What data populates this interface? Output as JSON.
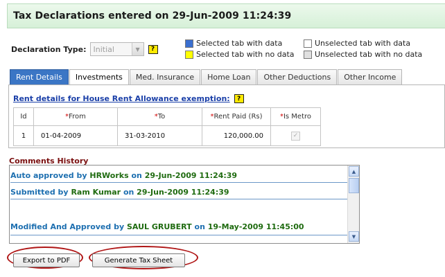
{
  "header": {
    "title": "Tax Declarations entered on 29-Jun-2009 11:24:39"
  },
  "declaration": {
    "label": "Declaration Type:",
    "selected": "Initial",
    "help": "?"
  },
  "legend": [
    {
      "text": "Selected tab with data",
      "color": "#3a6fd0"
    },
    {
      "text": "Selected tab with no data",
      "color": "#ffff00"
    },
    {
      "text": "Unselected tab with data",
      "color": "#ffffff"
    },
    {
      "text": "Unselected tab with no data",
      "color": "#e0e0e0"
    }
  ],
  "tabs": [
    "Rent Details",
    "Investments",
    "Med. Insurance",
    "Home Loan",
    "Other Deductions",
    "Other Income"
  ],
  "rent": {
    "heading": "Rent details for House Rent Allowance exemption:",
    "help": "?",
    "columns": {
      "id": "Id",
      "from": "From",
      "to": "To",
      "rent": "Rent Paid (Rs)",
      "metro": "Is Metro"
    },
    "required_mark": "*",
    "rows": [
      {
        "id": "1",
        "from": "01-04-2009",
        "to": "31-03-2010",
        "rent": "120,000.00",
        "metro": "✓"
      }
    ]
  },
  "comments": {
    "title": "Comments History",
    "entries": [
      {
        "prefix": "Auto approved by",
        "name": "HRWorks",
        "on": "on",
        "date": "29-Jun-2009 11:24:39"
      },
      {
        "prefix": "Submitted by",
        "name": "Ram Kumar",
        "on": "on",
        "date": "29-Jun-2009 11:24:39"
      },
      {
        "prefix": "Modified And Approved by",
        "name": "SAUL GRUBERT",
        "on": "on",
        "date": "19-May-2009 11:45:00"
      }
    ]
  },
  "buttons": {
    "export": "Export to PDF",
    "generate": "Generate Tax Sheet"
  }
}
